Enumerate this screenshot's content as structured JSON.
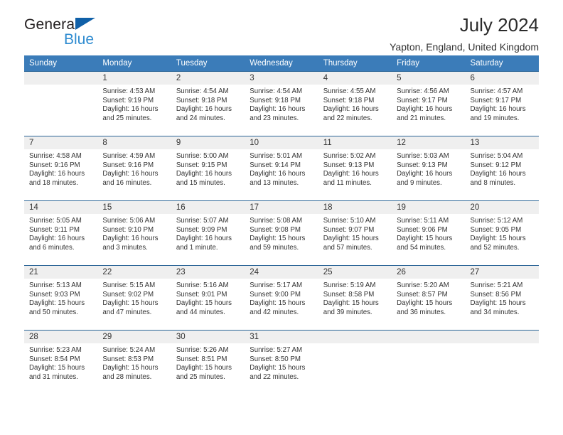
{
  "brand": {
    "line1": "General",
    "line2": "Blue",
    "triangle_color": "#1060a8",
    "blue_text_color": "#2e8bd0"
  },
  "header": {
    "title": "July 2024",
    "subtitle": "Yapton, England, United Kingdom"
  },
  "theme": {
    "header_row_bg": "#3b7cb9",
    "row_border": "#2a6496",
    "daynum_bg": "#efefef"
  },
  "weekday_headers": [
    "Sunday",
    "Monday",
    "Tuesday",
    "Wednesday",
    "Thursday",
    "Friday",
    "Saturday"
  ],
  "weeks": [
    [
      {
        "day": "",
        "sunrise": "",
        "sunset": "",
        "daylight1": "",
        "daylight2": ""
      },
      {
        "day": "1",
        "sunrise": "Sunrise: 4:53 AM",
        "sunset": "Sunset: 9:19 PM",
        "daylight1": "Daylight: 16 hours",
        "daylight2": "and 25 minutes."
      },
      {
        "day": "2",
        "sunrise": "Sunrise: 4:54 AM",
        "sunset": "Sunset: 9:18 PM",
        "daylight1": "Daylight: 16 hours",
        "daylight2": "and 24 minutes."
      },
      {
        "day": "3",
        "sunrise": "Sunrise: 4:54 AM",
        "sunset": "Sunset: 9:18 PM",
        "daylight1": "Daylight: 16 hours",
        "daylight2": "and 23 minutes."
      },
      {
        "day": "4",
        "sunrise": "Sunrise: 4:55 AM",
        "sunset": "Sunset: 9:18 PM",
        "daylight1": "Daylight: 16 hours",
        "daylight2": "and 22 minutes."
      },
      {
        "day": "5",
        "sunrise": "Sunrise: 4:56 AM",
        "sunset": "Sunset: 9:17 PM",
        "daylight1": "Daylight: 16 hours",
        "daylight2": "and 21 minutes."
      },
      {
        "day": "6",
        "sunrise": "Sunrise: 4:57 AM",
        "sunset": "Sunset: 9:17 PM",
        "daylight1": "Daylight: 16 hours",
        "daylight2": "and 19 minutes."
      }
    ],
    [
      {
        "day": "7",
        "sunrise": "Sunrise: 4:58 AM",
        "sunset": "Sunset: 9:16 PM",
        "daylight1": "Daylight: 16 hours",
        "daylight2": "and 18 minutes."
      },
      {
        "day": "8",
        "sunrise": "Sunrise: 4:59 AM",
        "sunset": "Sunset: 9:16 PM",
        "daylight1": "Daylight: 16 hours",
        "daylight2": "and 16 minutes."
      },
      {
        "day": "9",
        "sunrise": "Sunrise: 5:00 AM",
        "sunset": "Sunset: 9:15 PM",
        "daylight1": "Daylight: 16 hours",
        "daylight2": "and 15 minutes."
      },
      {
        "day": "10",
        "sunrise": "Sunrise: 5:01 AM",
        "sunset": "Sunset: 9:14 PM",
        "daylight1": "Daylight: 16 hours",
        "daylight2": "and 13 minutes."
      },
      {
        "day": "11",
        "sunrise": "Sunrise: 5:02 AM",
        "sunset": "Sunset: 9:13 PM",
        "daylight1": "Daylight: 16 hours",
        "daylight2": "and 11 minutes."
      },
      {
        "day": "12",
        "sunrise": "Sunrise: 5:03 AM",
        "sunset": "Sunset: 9:13 PM",
        "daylight1": "Daylight: 16 hours",
        "daylight2": "and 9 minutes."
      },
      {
        "day": "13",
        "sunrise": "Sunrise: 5:04 AM",
        "sunset": "Sunset: 9:12 PM",
        "daylight1": "Daylight: 16 hours",
        "daylight2": "and 8 minutes."
      }
    ],
    [
      {
        "day": "14",
        "sunrise": "Sunrise: 5:05 AM",
        "sunset": "Sunset: 9:11 PM",
        "daylight1": "Daylight: 16 hours",
        "daylight2": "and 6 minutes."
      },
      {
        "day": "15",
        "sunrise": "Sunrise: 5:06 AM",
        "sunset": "Sunset: 9:10 PM",
        "daylight1": "Daylight: 16 hours",
        "daylight2": "and 3 minutes."
      },
      {
        "day": "16",
        "sunrise": "Sunrise: 5:07 AM",
        "sunset": "Sunset: 9:09 PM",
        "daylight1": "Daylight: 16 hours",
        "daylight2": "and 1 minute."
      },
      {
        "day": "17",
        "sunrise": "Sunrise: 5:08 AM",
        "sunset": "Sunset: 9:08 PM",
        "daylight1": "Daylight: 15 hours",
        "daylight2": "and 59 minutes."
      },
      {
        "day": "18",
        "sunrise": "Sunrise: 5:10 AM",
        "sunset": "Sunset: 9:07 PM",
        "daylight1": "Daylight: 15 hours",
        "daylight2": "and 57 minutes."
      },
      {
        "day": "19",
        "sunrise": "Sunrise: 5:11 AM",
        "sunset": "Sunset: 9:06 PM",
        "daylight1": "Daylight: 15 hours",
        "daylight2": "and 54 minutes."
      },
      {
        "day": "20",
        "sunrise": "Sunrise: 5:12 AM",
        "sunset": "Sunset: 9:05 PM",
        "daylight1": "Daylight: 15 hours",
        "daylight2": "and 52 minutes."
      }
    ],
    [
      {
        "day": "21",
        "sunrise": "Sunrise: 5:13 AM",
        "sunset": "Sunset: 9:03 PM",
        "daylight1": "Daylight: 15 hours",
        "daylight2": "and 50 minutes."
      },
      {
        "day": "22",
        "sunrise": "Sunrise: 5:15 AM",
        "sunset": "Sunset: 9:02 PM",
        "daylight1": "Daylight: 15 hours",
        "daylight2": "and 47 minutes."
      },
      {
        "day": "23",
        "sunrise": "Sunrise: 5:16 AM",
        "sunset": "Sunset: 9:01 PM",
        "daylight1": "Daylight: 15 hours",
        "daylight2": "and 44 minutes."
      },
      {
        "day": "24",
        "sunrise": "Sunrise: 5:17 AM",
        "sunset": "Sunset: 9:00 PM",
        "daylight1": "Daylight: 15 hours",
        "daylight2": "and 42 minutes."
      },
      {
        "day": "25",
        "sunrise": "Sunrise: 5:19 AM",
        "sunset": "Sunset: 8:58 PM",
        "daylight1": "Daylight: 15 hours",
        "daylight2": "and 39 minutes."
      },
      {
        "day": "26",
        "sunrise": "Sunrise: 5:20 AM",
        "sunset": "Sunset: 8:57 PM",
        "daylight1": "Daylight: 15 hours",
        "daylight2": "and 36 minutes."
      },
      {
        "day": "27",
        "sunrise": "Sunrise: 5:21 AM",
        "sunset": "Sunset: 8:56 PM",
        "daylight1": "Daylight: 15 hours",
        "daylight2": "and 34 minutes."
      }
    ],
    [
      {
        "day": "28",
        "sunrise": "Sunrise: 5:23 AM",
        "sunset": "Sunset: 8:54 PM",
        "daylight1": "Daylight: 15 hours",
        "daylight2": "and 31 minutes."
      },
      {
        "day": "29",
        "sunrise": "Sunrise: 5:24 AM",
        "sunset": "Sunset: 8:53 PM",
        "daylight1": "Daylight: 15 hours",
        "daylight2": "and 28 minutes."
      },
      {
        "day": "30",
        "sunrise": "Sunrise: 5:26 AM",
        "sunset": "Sunset: 8:51 PM",
        "daylight1": "Daylight: 15 hours",
        "daylight2": "and 25 minutes."
      },
      {
        "day": "31",
        "sunrise": "Sunrise: 5:27 AM",
        "sunset": "Sunset: 8:50 PM",
        "daylight1": "Daylight: 15 hours",
        "daylight2": "and 22 minutes."
      },
      {
        "day": "",
        "sunrise": "",
        "sunset": "",
        "daylight1": "",
        "daylight2": ""
      },
      {
        "day": "",
        "sunrise": "",
        "sunset": "",
        "daylight1": "",
        "daylight2": ""
      },
      {
        "day": "",
        "sunrise": "",
        "sunset": "",
        "daylight1": "",
        "daylight2": ""
      }
    ]
  ]
}
